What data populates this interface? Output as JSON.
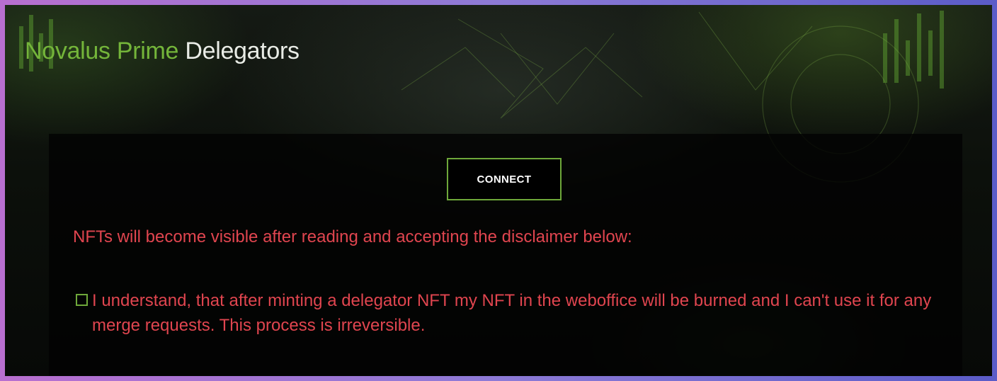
{
  "header": {
    "brand": "Novalus Prime",
    "title_rest": "Delegators"
  },
  "panel": {
    "connect_label": "CONNECT",
    "notice": "NFTs will become visible after reading and accepting the disclaimer below:",
    "disclaimer": {
      "checked": false,
      "text": "I understand, that after minting a delegator NFT my NFT in the weboffice will be burned and I can't use it for any merge requests. This process is irreversible."
    }
  },
  "colors": {
    "brand_green": "#74b53a",
    "accent_border": "#6ea83a",
    "warning_red": "#e0454f",
    "frame_gradient_start": "#b86fd0",
    "frame_gradient_end": "#5b5cc8"
  }
}
